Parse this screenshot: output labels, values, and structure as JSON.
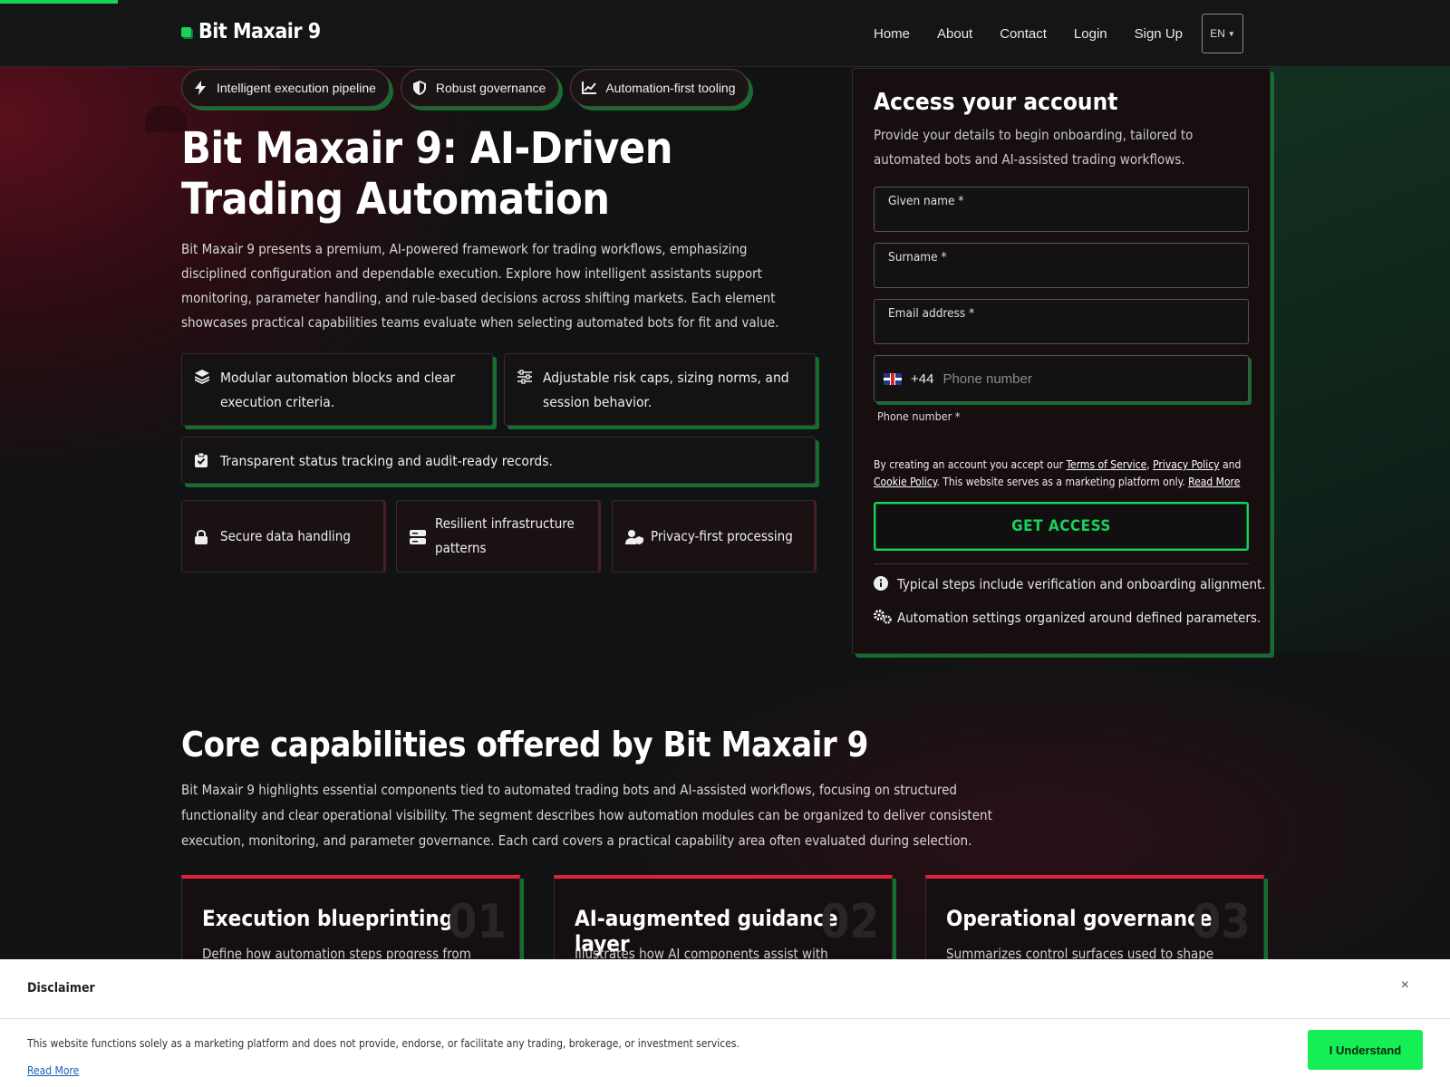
{
  "header": {
    "brand": "Bit Maxair 9",
    "nav": [
      "Home",
      "About",
      "Contact",
      "Login",
      "Sign Up"
    ],
    "language": "EN"
  },
  "hero": {
    "chips": [
      {
        "label": "Intelligent execution pipeline",
        "icon": "bolt-icon"
      },
      {
        "label": "Robust governance",
        "icon": "shield-icon"
      },
      {
        "label": "Automation-first tooling",
        "icon": "chart-line-icon"
      }
    ],
    "title": "Bit Maxair 9: AI-Driven Trading Automation",
    "description": "Bit Maxair 9 presents a premium, AI-powered framework for trading workflows, emphasizing disciplined configuration and dependable execution. Explore how intelligent assistants support monitoring, parameter handling, and rule-based decisions across shifting markets. Each element showcases practical capabilities teams evaluate when selecting automated bots for fit and value.",
    "features": [
      {
        "text": "Modular automation blocks and clear execution criteria.",
        "icon": "layers-icon"
      },
      {
        "text": "Adjustable risk caps, sizing norms, and session behavior.",
        "icon": "sliders-icon"
      },
      {
        "text": "Transparent status tracking and audit-ready records.",
        "icon": "clipboard-check-icon"
      }
    ],
    "badges": [
      {
        "text": "Secure data handling",
        "icon": "lock-icon"
      },
      {
        "text": "Resilient infrastructure patterns",
        "icon": "server-icon"
      },
      {
        "text": "Privacy-first processing",
        "icon": "user-shield-icon"
      }
    ]
  },
  "form": {
    "title": "Access your account",
    "description": "Provide your details to begin onboarding, tailored to automated bots and AI-assisted trading workflows.",
    "given_name_label": "Given name *",
    "surname_label": "Surname *",
    "email_label": "Email address *",
    "phone_prefix": "+44",
    "phone_placeholder": "Phone number",
    "phone_label": "Phone number *",
    "terms_prefix": "By creating an account you accept our ",
    "terms_link": "Terms of Service",
    "privacy_link": "Privacy Policy",
    "and": " and",
    "cookie_link": "Cookie Policy",
    "terms_suffix": ". This website serves as a marketing platform only. ",
    "read_more": "Read More",
    "submit": "GET ACCESS",
    "notes": [
      {
        "text": "Typical steps include verification and onboarding alignment.",
        "icon": "info-icon"
      },
      {
        "text": "Automation settings organized around defined parameters.",
        "icon": "gears-icon"
      }
    ]
  },
  "capabilities": {
    "title": "Core capabilities offered by Bit Maxair 9",
    "description": "Bit Maxair 9 highlights essential components tied to automated trading bots and AI-assisted workflows, focusing on structured functionality and clear operational visibility. The segment describes how automation modules can be organized to deliver consistent execution, monitoring, and parameter governance. Each card covers a practical capability area often evaluated during selection.",
    "cards": [
      {
        "title": "Execution blueprinting",
        "num": "01",
        "text": "Define how automation steps progress from data"
      },
      {
        "title": "AI-augmented guidance layer",
        "num": "02",
        "text": "Illustrates how AI components assist with pattern"
      },
      {
        "title": "Operational governance",
        "num": "03",
        "text": "Summarizes control surfaces used to shape"
      }
    ]
  },
  "disclaimer": {
    "title": "Disclaimer",
    "close": "×",
    "text": "This website functions solely as a marketing platform and does not provide, endorse, or facilitate any trading, brokerage, or investment services.",
    "link": "Read More",
    "button": "I Understand"
  },
  "colors": {
    "accent_green": "#17d15a",
    "accent_red": "#e0213a",
    "background": "#111213"
  }
}
